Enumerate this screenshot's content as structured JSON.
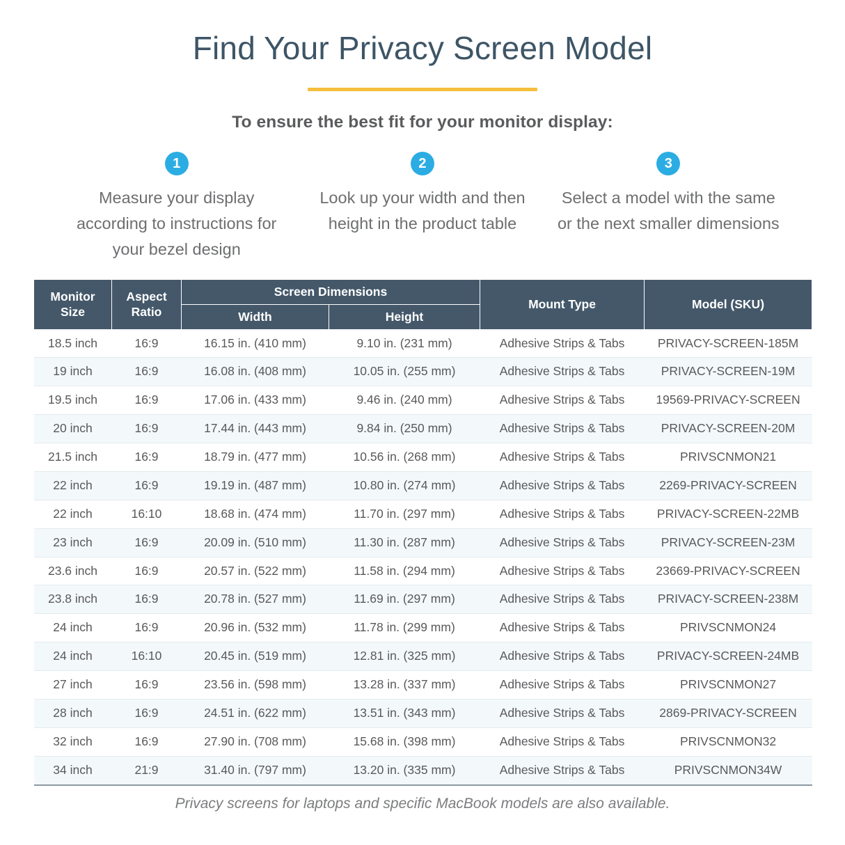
{
  "header": {
    "title": "Find Your Privacy Screen Model",
    "accent_color": "#f5bf3c",
    "subtitle": "To ensure the best fit for your monitor display:"
  },
  "steps": [
    {
      "number": "1",
      "text": "Measure your display according to instructions for your bezel design"
    },
    {
      "number": "2",
      "text": "Look up your width and then height in the product table"
    },
    {
      "number": "3",
      "text": "Select a model with the same or the next smaller dimensions"
    }
  ],
  "step_badge_color": "#2badE3",
  "table": {
    "header_color": "#44586a",
    "group_header": "Screen Dimensions",
    "columns": {
      "monitor_size": "Monitor Size",
      "aspect_ratio": "Aspect Ratio",
      "width": "Width",
      "height": "Height",
      "mount_type": "Mount Type",
      "model_sku": "Model (SKU)"
    },
    "rows": [
      {
        "size": "18.5 inch",
        "ratio": "16:9",
        "width": "16.15 in. (410 mm)",
        "height": "9.10 in. (231 mm)",
        "mount": "Adhesive Strips & Tabs",
        "model": "PRIVACY-SCREEN-185M"
      },
      {
        "size": "19 inch",
        "ratio": "16:9",
        "width": "16.08 in. (408 mm)",
        "height": "10.05 in. (255 mm)",
        "mount": "Adhesive Strips & Tabs",
        "model": "PRIVACY-SCREEN-19M"
      },
      {
        "size": "19.5 inch",
        "ratio": "16:9",
        "width": "17.06 in. (433 mm)",
        "height": "9.46 in. (240 mm)",
        "mount": "Adhesive Strips & Tabs",
        "model": "19569-PRIVACY-SCREEN"
      },
      {
        "size": "20 inch",
        "ratio": "16:9",
        "width": "17.44 in. (443 mm)",
        "height": "9.84 in. (250 mm)",
        "mount": "Adhesive Strips & Tabs",
        "model": "PRIVACY-SCREEN-20M"
      },
      {
        "size": "21.5 inch",
        "ratio": "16:9",
        "width": "18.79 in. (477 mm)",
        "height": "10.56 in. (268 mm)",
        "mount": "Adhesive Strips & Tabs",
        "model": "PRIVSCNMON21"
      },
      {
        "size": "22 inch",
        "ratio": "16:9",
        "width": "19.19 in. (487 mm)",
        "height": "10.80 in. (274 mm)",
        "mount": "Adhesive Strips & Tabs",
        "model": "2269-PRIVACY-SCREEN"
      },
      {
        "size": "22 inch",
        "ratio": "16:10",
        "width": "18.68 in. (474 mm)",
        "height": "11.70 in. (297 mm)",
        "mount": "Adhesive Strips & Tabs",
        "model": "PRIVACY-SCREEN-22MB"
      },
      {
        "size": "23 inch",
        "ratio": "16:9",
        "width": "20.09 in. (510 mm)",
        "height": "11.30 in. (287 mm)",
        "mount": "Adhesive Strips & Tabs",
        "model": "PRIVACY-SCREEN-23M"
      },
      {
        "size": "23.6 inch",
        "ratio": "16:9",
        "width": "20.57 in. (522 mm)",
        "height": "11.58 in. (294 mm)",
        "mount": "Adhesive Strips & Tabs",
        "model": "23669-PRIVACY-SCREEN"
      },
      {
        "size": "23.8 inch",
        "ratio": "16:9",
        "width": "20.78 in. (527 mm)",
        "height": "11.69 in. (297 mm)",
        "mount": "Adhesive Strips & Tabs",
        "model": "PRIVACY-SCREEN-238M"
      },
      {
        "size": "24 inch",
        "ratio": "16:9",
        "width": "20.96 in. (532 mm)",
        "height": "11.78 in. (299 mm)",
        "mount": "Adhesive Strips & Tabs",
        "model": "PRIVSCNMON24"
      },
      {
        "size": "24 inch",
        "ratio": "16:10",
        "width": "20.45 in. (519 mm)",
        "height": "12.81 in. (325 mm)",
        "mount": "Adhesive Strips & Tabs",
        "model": "PRIVACY-SCREEN-24MB"
      },
      {
        "size": "27 inch",
        "ratio": "16:9",
        "width": "23.56 in. (598 mm)",
        "height": "13.28 in. (337 mm)",
        "mount": "Adhesive Strips & Tabs",
        "model": "PRIVSCNMON27"
      },
      {
        "size": "28 inch",
        "ratio": "16:9",
        "width": "24.51 in. (622 mm)",
        "height": "13.51 in. (343 mm)",
        "mount": "Adhesive Strips & Tabs",
        "model": "2869-PRIVACY-SCREEN"
      },
      {
        "size": "32 inch",
        "ratio": "16:9",
        "width": "27.90 in. (708 mm)",
        "height": "15.68 in. (398 mm)",
        "mount": "Adhesive Strips & Tabs",
        "model": "PRIVSCNMON32"
      },
      {
        "size": "34 inch",
        "ratio": "21:9",
        "width": "31.40 in. (797 mm)",
        "height": "13.20 in. (335 mm)",
        "mount": "Adhesive Strips & Tabs",
        "model": "PRIVSCNMON34W"
      }
    ]
  },
  "footnote": "Privacy screens for laptops and specific MacBook models are also available."
}
